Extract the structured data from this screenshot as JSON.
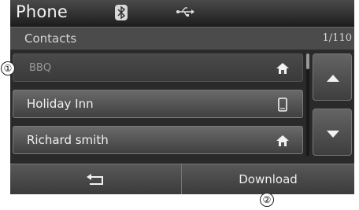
{
  "header": {
    "title": "Phone",
    "bluetooth_icon": "bluetooth-icon",
    "usb_icon": "usb-icon"
  },
  "subheader": {
    "title": "Contacts",
    "page_count": "1/110"
  },
  "contacts": [
    {
      "name": "BBQ",
      "icon": "home-icon",
      "selected": true
    },
    {
      "name": "Holiday Inn",
      "icon": "mobile-phone-icon",
      "selected": false
    },
    {
      "name": "Richard smith",
      "icon": "home-icon",
      "selected": false
    }
  ],
  "scroll": {
    "up_icon": "triangle-up-icon",
    "down_icon": "triangle-down-icon"
  },
  "footer": {
    "back_icon": "back-arrow-icon",
    "download_label": "Download"
  },
  "callouts": [
    "①",
    "②"
  ],
  "colors": {
    "background": "#2a2a2a",
    "button": "#505050",
    "text": "#f0f0f0"
  }
}
